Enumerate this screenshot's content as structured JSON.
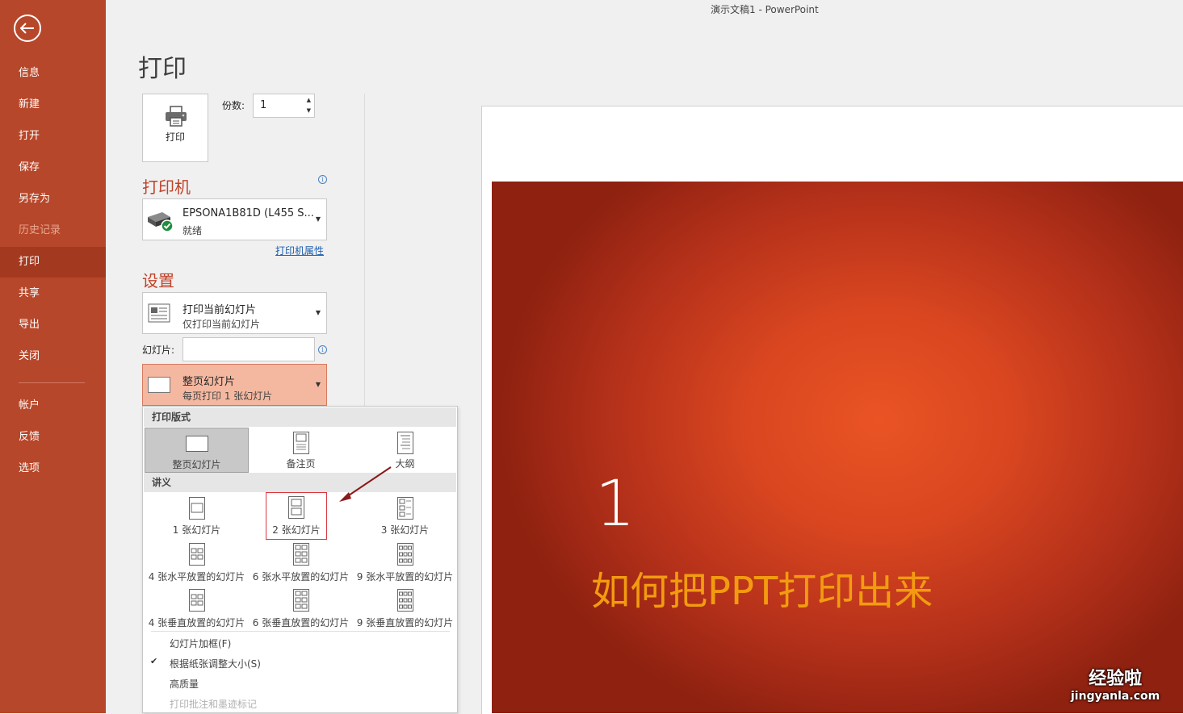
{
  "window_title": "演示文稿1  -  PowerPoint",
  "sidebar": {
    "items": [
      {
        "label": "信息",
        "state": "normal"
      },
      {
        "label": "新建",
        "state": "normal"
      },
      {
        "label": "打开",
        "state": "normal"
      },
      {
        "label": "保存",
        "state": "normal"
      },
      {
        "label": "另存为",
        "state": "normal"
      },
      {
        "label": "历史记录",
        "state": "disabled"
      },
      {
        "label": "打印",
        "state": "selected"
      },
      {
        "label": "共享",
        "state": "normal"
      },
      {
        "label": "导出",
        "state": "normal"
      },
      {
        "label": "关闭",
        "state": "normal"
      }
    ],
    "bottom_items": [
      {
        "label": "帐户"
      },
      {
        "label": "反馈"
      },
      {
        "label": "选项"
      }
    ]
  },
  "print": {
    "title": "打印",
    "print_button_label": "打印",
    "copies_label": "份数:",
    "copies_value": "1"
  },
  "printer": {
    "section_title": "打印机",
    "name": "EPSONA1B81D (L455 S...",
    "status": "就绪",
    "properties_link": "打印机属性"
  },
  "settings": {
    "section_title": "设置",
    "range": {
      "title": "打印当前幻灯片",
      "subtitle": "仅打印当前幻灯片"
    },
    "slides_label": "幻灯片:",
    "slides_value": "",
    "layout": {
      "title": "整页幻灯片",
      "subtitle": "每页打印 1 张幻灯片"
    }
  },
  "layout_popup": {
    "print_layout_header": "打印版式",
    "print_layouts": [
      "整页幻灯片",
      "备注页",
      "大纲"
    ],
    "handouts_header": "讲义",
    "handouts": [
      "1 张幻灯片",
      "2 张幻灯片",
      "3 张幻灯片",
      "4 张水平放置的幻灯片",
      "6 张水平放置的幻灯片",
      "9 张水平放置的幻灯片",
      "4 张垂直放置的幻灯片",
      "6 张垂直放置的幻灯片",
      "9 张垂直放置的幻灯片"
    ],
    "options": [
      {
        "label": "幻灯片加框(F)",
        "checked": false,
        "disabled": false
      },
      {
        "label": "根据纸张调整大小(S)",
        "checked": true,
        "disabled": false
      },
      {
        "label": "高质量",
        "checked": false,
        "disabled": false
      },
      {
        "label": "打印批注和墨迹标记",
        "checked": false,
        "disabled": true
      }
    ]
  },
  "preview": {
    "slide_number": "1",
    "slide_title": "如何把PPT打印出来"
  },
  "watermark": {
    "line1": "经验啦",
    "line2": "jingyanla.com"
  },
  "colors": {
    "sidebar": "#b7472a",
    "sidebar_selected": "#a33a1f",
    "accent": "#c0432a",
    "slide_title": "#f29b10",
    "highlight_box": "#d9363e",
    "arrow": "#8b1a1a"
  }
}
